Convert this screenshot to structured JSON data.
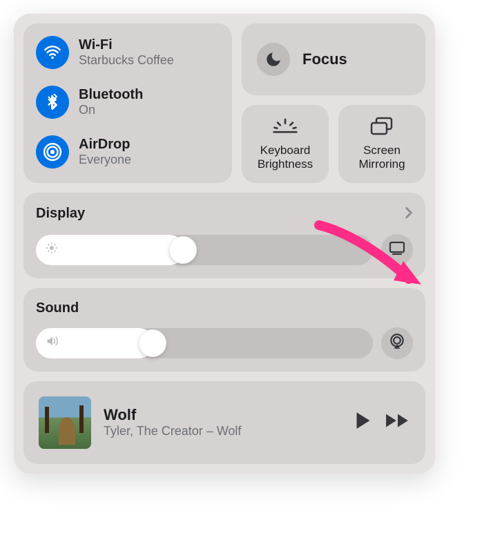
{
  "connectivity": {
    "wifi": {
      "label": "Wi-Fi",
      "status": "Starbucks Coffee"
    },
    "bluetooth": {
      "label": "Bluetooth",
      "status": "On"
    },
    "airdrop": {
      "label": "AirDrop",
      "status": "Everyone"
    }
  },
  "focus": {
    "label": "Focus"
  },
  "shortcuts": {
    "keyboard_brightness": "Keyboard Brightness",
    "screen_mirroring": "Screen Mirroring"
  },
  "display": {
    "label": "Display",
    "slider_percent": 44
  },
  "sound": {
    "label": "Sound",
    "slider_percent": 35
  },
  "media": {
    "title": "Wolf",
    "subtitle": "Tyler, The Creator – Wolf"
  },
  "colors": {
    "accent_blue": "#0071e3",
    "arrow": "#ff2d87"
  }
}
